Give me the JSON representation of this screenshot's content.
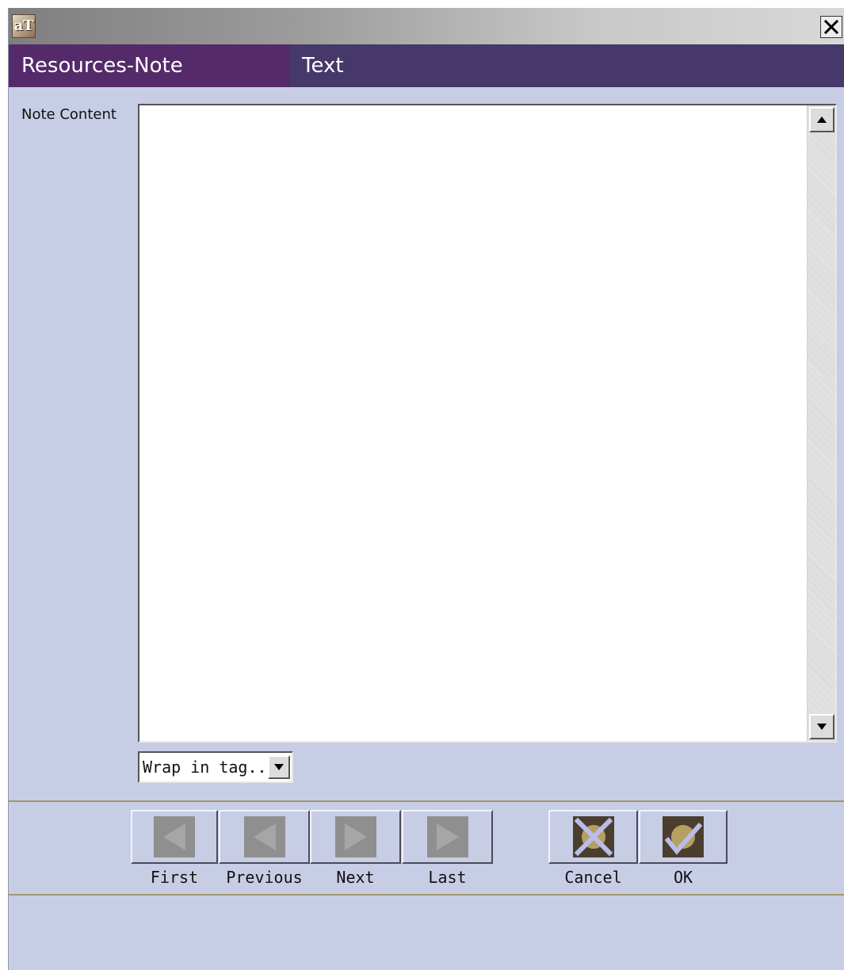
{
  "window": {
    "app_icon_text": "aT",
    "close_glyph": "✕"
  },
  "header": {
    "module": "Resources-Note",
    "section": "Text"
  },
  "form": {
    "note_content_label": "Note Content",
    "note_content_value": "",
    "wrap_select_value": "Wrap in tag..."
  },
  "nav": {
    "first": "First",
    "previous": "Previous",
    "next": "Next",
    "last": "Last",
    "cancel": "Cancel",
    "ok": "OK"
  },
  "colors": {
    "window_bg": "#c8cde6",
    "header_bg": "#46396a",
    "header_left_bg": "#552a6a",
    "separator": "#a4966a"
  }
}
